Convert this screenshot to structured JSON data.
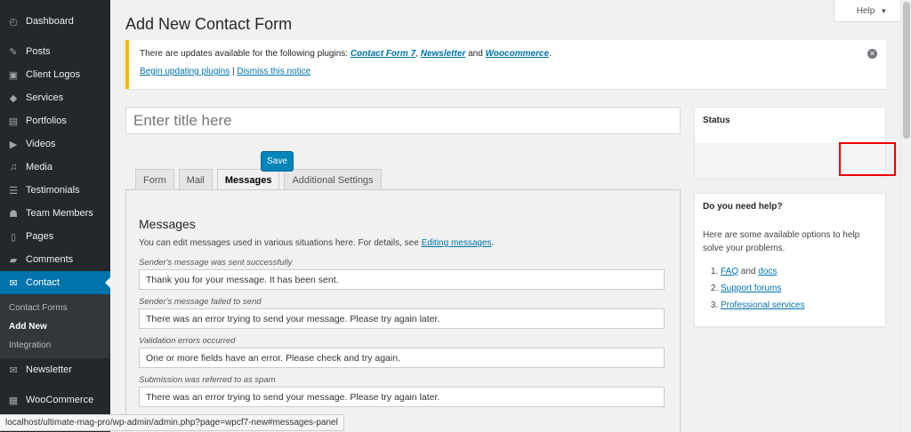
{
  "sidebar": {
    "items": [
      {
        "label": "Dashboard",
        "icon": "dashboard-icon",
        "glyph": "◴"
      },
      {
        "label": "Posts",
        "icon": "pushpin-icon",
        "glyph": "✎"
      },
      {
        "label": "Client Logos",
        "icon": "image-icon",
        "glyph": "▣"
      },
      {
        "label": "Services",
        "icon": "tag-icon",
        "glyph": "◆"
      },
      {
        "label": "Portfolios",
        "icon": "folder-icon",
        "glyph": "▤"
      },
      {
        "label": "Videos",
        "icon": "video-icon",
        "glyph": "▶"
      },
      {
        "label": "Media",
        "icon": "media-icon",
        "glyph": "♫"
      },
      {
        "label": "Testimonials",
        "icon": "comment-text-icon",
        "glyph": "☰"
      },
      {
        "label": "Team Members",
        "icon": "group-icon",
        "glyph": "☗"
      },
      {
        "label": "Pages",
        "icon": "page-icon",
        "glyph": "▯"
      },
      {
        "label": "Comments",
        "icon": "comment-icon",
        "glyph": "▰"
      }
    ],
    "contact": {
      "label": "Contact",
      "icon": "email-icon",
      "glyph": "✉"
    },
    "submenu": [
      "Contact Forms",
      "Add New",
      "Integration"
    ],
    "after": [
      {
        "label": "Newsletter",
        "icon": "mail-icon",
        "glyph": "✉"
      },
      {
        "label": "WooCommerce",
        "icon": "woocommerce-icon",
        "glyph": "▦"
      }
    ]
  },
  "header": {
    "title": "Add New Contact Form",
    "help": "Help"
  },
  "notice": {
    "prefix": "There are updates available for the following plugins: ",
    "plugin1": "Contact Form 7",
    "sep1": ", ",
    "plugin2": "Newsletter",
    "sep2": " and ",
    "plugin3": "Woocommerce",
    "suffix": ".",
    "begin": "Begin updating plugins",
    "pipe": " | ",
    "dismiss": "Dismiss this notice",
    "close_glyph": "✕"
  },
  "title_input": {
    "placeholder": "Enter title here"
  },
  "tabs": [
    "Form",
    "Mail",
    "Messages",
    "Additional Settings"
  ],
  "messages": {
    "heading": "Messages",
    "desc": "You can edit messages used in various situations here. For details, see ",
    "desc_link": "Editing messages",
    "desc_end": ".",
    "fields": [
      {
        "label": "Sender's message was sent successfully",
        "value": "Thank you for your message. It has been sent."
      },
      {
        "label": "Sender's message failed to send",
        "value": "There was an error trying to send your message. Please try again later."
      },
      {
        "label": "Validation errors occurred",
        "value": "One or more fields have an error. Please check and try again."
      },
      {
        "label": "Submission was referred to as spam",
        "value": "There was an error trying to send your message. Please try again later."
      }
    ]
  },
  "status": {
    "title": "Status",
    "save": "Save"
  },
  "help_box": {
    "title": "Do you need help?",
    "text": "Here are some available options to help solve your problems.",
    "faq": "FAQ",
    "and": " and ",
    "docs": "docs",
    "support": "Support forums",
    "pro": "Professional services"
  },
  "status_url": "localhost/ultimate-mag-pro/wp-admin/admin.php?page=wpcf7-new#messages-panel"
}
